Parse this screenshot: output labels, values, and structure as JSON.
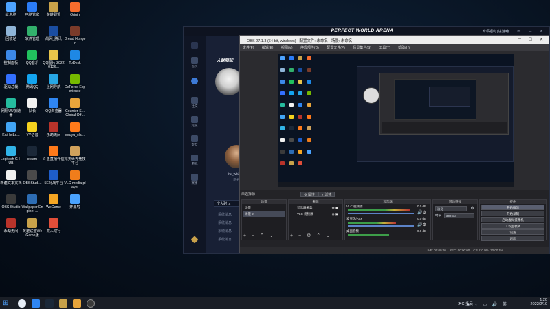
{
  "desktop": {
    "icons": [
      {
        "label": "此电脑",
        "color": "#4da3ff"
      },
      {
        "label": "电脑管家",
        "color": "#2b7cf6"
      },
      {
        "label": "英雄联盟",
        "color": "#c8a24a"
      },
      {
        "label": "Origin",
        "color": "#f56c2d"
      },
      {
        "label": "回收站",
        "color": "#8fb5d8"
      },
      {
        "label": "软件管理",
        "color": "#32b16c"
      },
      {
        "label": "战网_腾讯",
        "color": "#1a4da1"
      },
      {
        "label": "Dread Hunger",
        "color": "#7a3b2a"
      },
      {
        "label": "控制面板",
        "color": "#3c89e8"
      },
      {
        "label": "QQ音乐",
        "color": "#21c25e"
      },
      {
        "label": "QQ图片 20220126...",
        "color": "#e7c44b"
      },
      {
        "label": "ToDesk",
        "color": "#1e88e5"
      },
      {
        "label": "驱动总裁",
        "color": "#3370ff"
      },
      {
        "label": "腾讯QQ",
        "color": "#13a4f0"
      },
      {
        "label": "上网导航",
        "color": "#27a6e5"
      },
      {
        "label": "GeForce Experience",
        "color": "#76b900"
      },
      {
        "label": "网易UU加速器",
        "color": "#25bc9f"
      },
      {
        "label": "队长",
        "color": "#f2f2f2"
      },
      {
        "label": "QQ浏览器",
        "color": "#2f86f2"
      },
      {
        "label": "Counter-S... Global Off...",
        "color": "#e8a53b"
      },
      {
        "label": "KaiHeiLa...",
        "color": "#42a5f5"
      },
      {
        "label": "YY语音",
        "color": "#f5d21e"
      },
      {
        "label": "永劫无间",
        "color": "#b8332a"
      },
      {
        "label": "douyu_cla...",
        "color": "#ff7a1a"
      },
      {
        "label": "Logitech G HUB",
        "color": "#31b4e8"
      },
      {
        "label": "steam",
        "color": "#1b2838"
      },
      {
        "label": "斗鱼直播伴侣",
        "color": "#ff7a1a"
      },
      {
        "label": "完美世界竞技平台",
        "color": "#d0a25c"
      },
      {
        "label": "新建文本文档",
        "color": "#f0f0f0"
      },
      {
        "label": "OBSStudi...",
        "color": "#4a4a4a"
      },
      {
        "label": "5E对战平台",
        "color": "#1e5dc9"
      },
      {
        "label": "VLC media player",
        "color": "#f07d1b"
      },
      {
        "label": "OBS Studio",
        "color": "#3a3a3a"
      },
      {
        "label": "Wallpaper Engine: ...",
        "color": "#2d6db4"
      },
      {
        "label": "WeGame",
        "color": "#f5a623"
      },
      {
        "label": "开黑啦",
        "color": "#4aa3ff"
      },
      {
        "label": "永劫无间",
        "color": "#b8332a"
      },
      {
        "label": "英雄联盟WeGame版",
        "color": "#c8a24a"
      },
      {
        "label": "双人成行",
        "color": "#e04e39"
      }
    ]
  },
  "launcher": {
    "brand": "PERFECT WORLD ARENA",
    "right_title": "专项福利 [进游戏]",
    "nav": [
      "首页",
      "",
      "社交",
      "竞技",
      "交互",
      "游戏",
      "赛事",
      "",
      "赞赛工具"
    ],
    "user1_name": "人缺陨纪",
    "user2_name": "the_White55K",
    "user2_sub": "积分?",
    "search_text": "宁大耐 .c",
    "sys_msgs": [
      "系统消息",
      "系统消息",
      "系统消息",
      "系统消息",
      "系统消息",
      "系统消息"
    ]
  },
  "obs": {
    "title": "OBS 27.1.3 (64-bit, windows) - 配置文件: 未命名 - 场景: 未命名",
    "menu": [
      "文件(F)",
      "编辑(E)",
      "视图(V)",
      "停靠部件(D)",
      "配置文件(P)",
      "场景集合(S)",
      "工具(T)",
      "帮助(H)"
    ],
    "no_source": "未选择源",
    "props_label": "属性",
    "filters_label": "滤镜",
    "docks": {
      "scenes": {
        "title": "场景",
        "items": [
          "场景",
          "场景 2"
        ]
      },
      "sources": {
        "title": "来源",
        "items": [
          "显示器采集",
          "VLC 视频源"
        ]
      },
      "mixer": {
        "title": "混音器",
        "channels": [
          {
            "name": "VLC 视频源",
            "db": "0.0 dB"
          },
          {
            "name": "麦克风/Aux",
            "db": "0.0 dB"
          },
          {
            "name": "桌面音频",
            "db": "0.0 dB"
          }
        ]
      },
      "transitions": {
        "title": "转场特效",
        "type": "淡化",
        "duration_label": "时长",
        "duration": "300 ms"
      },
      "controls": {
        "title": "控件",
        "buttons": [
          "开始推流",
          "开始录制",
          "启动虚拟摄像机",
          "工作室模式",
          "设置",
          "退出"
        ]
      }
    },
    "status": {
      "live": "LIVE: 00:00:00",
      "rec": "REC: 00:00:00",
      "cpu": "CPU: 0.9%, 30.00 fps"
    }
  },
  "taskbar": {
    "weather": "2°C 多云",
    "time": "1:20",
    "date": "2022/2/19",
    "tray_lang": "英"
  }
}
